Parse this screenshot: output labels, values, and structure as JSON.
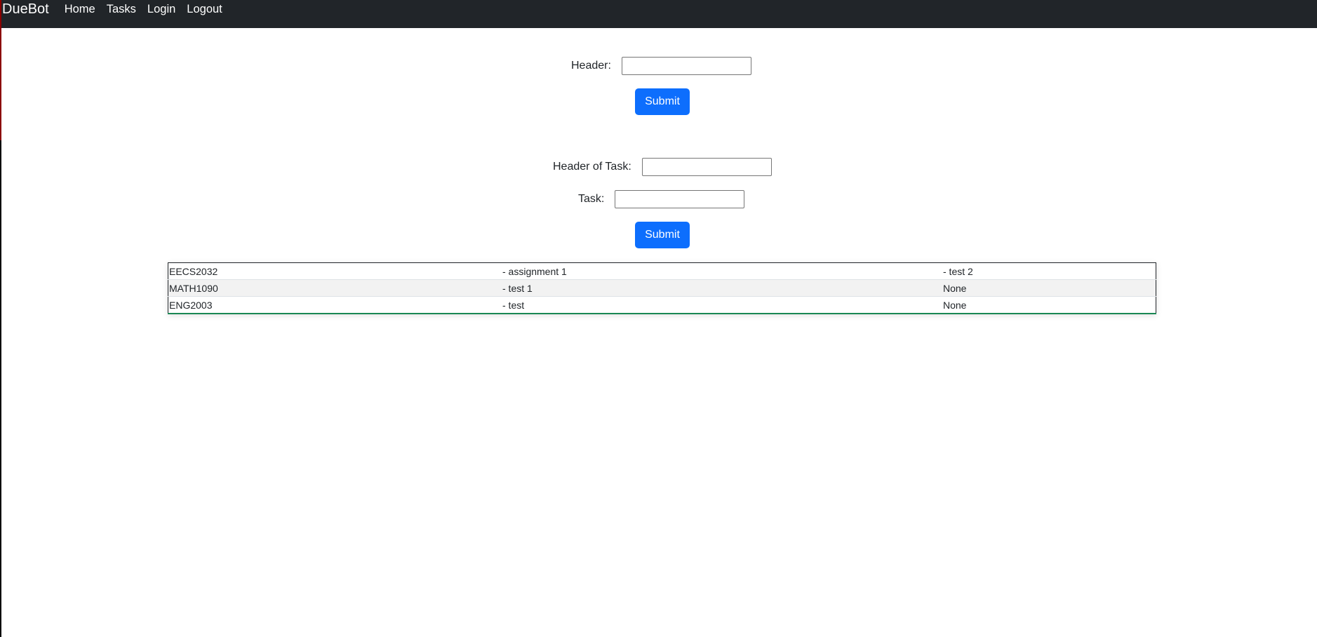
{
  "navbar": {
    "brand": "DueBot",
    "links": [
      "Home",
      "Tasks",
      "Login",
      "Logout"
    ]
  },
  "header_form": {
    "header_label": "Header:",
    "header_value": "",
    "submit_label": "Submit"
  },
  "task_form": {
    "header_of_task_label": "Header of Task:",
    "header_of_task_value": "",
    "task_label": "Task:",
    "task_value": "",
    "submit_label": "Submit"
  },
  "table": {
    "rows": [
      [
        "EECS2032",
        "- assignment 1",
        "- test 2"
      ],
      [
        "MATH1090",
        "- test 1",
        "None"
      ],
      [
        "ENG2003",
        "- test",
        "None"
      ]
    ]
  },
  "colors": {
    "navbar_bg": "#212529",
    "button_bg": "#0d6efd",
    "table_accent": "#198754"
  }
}
